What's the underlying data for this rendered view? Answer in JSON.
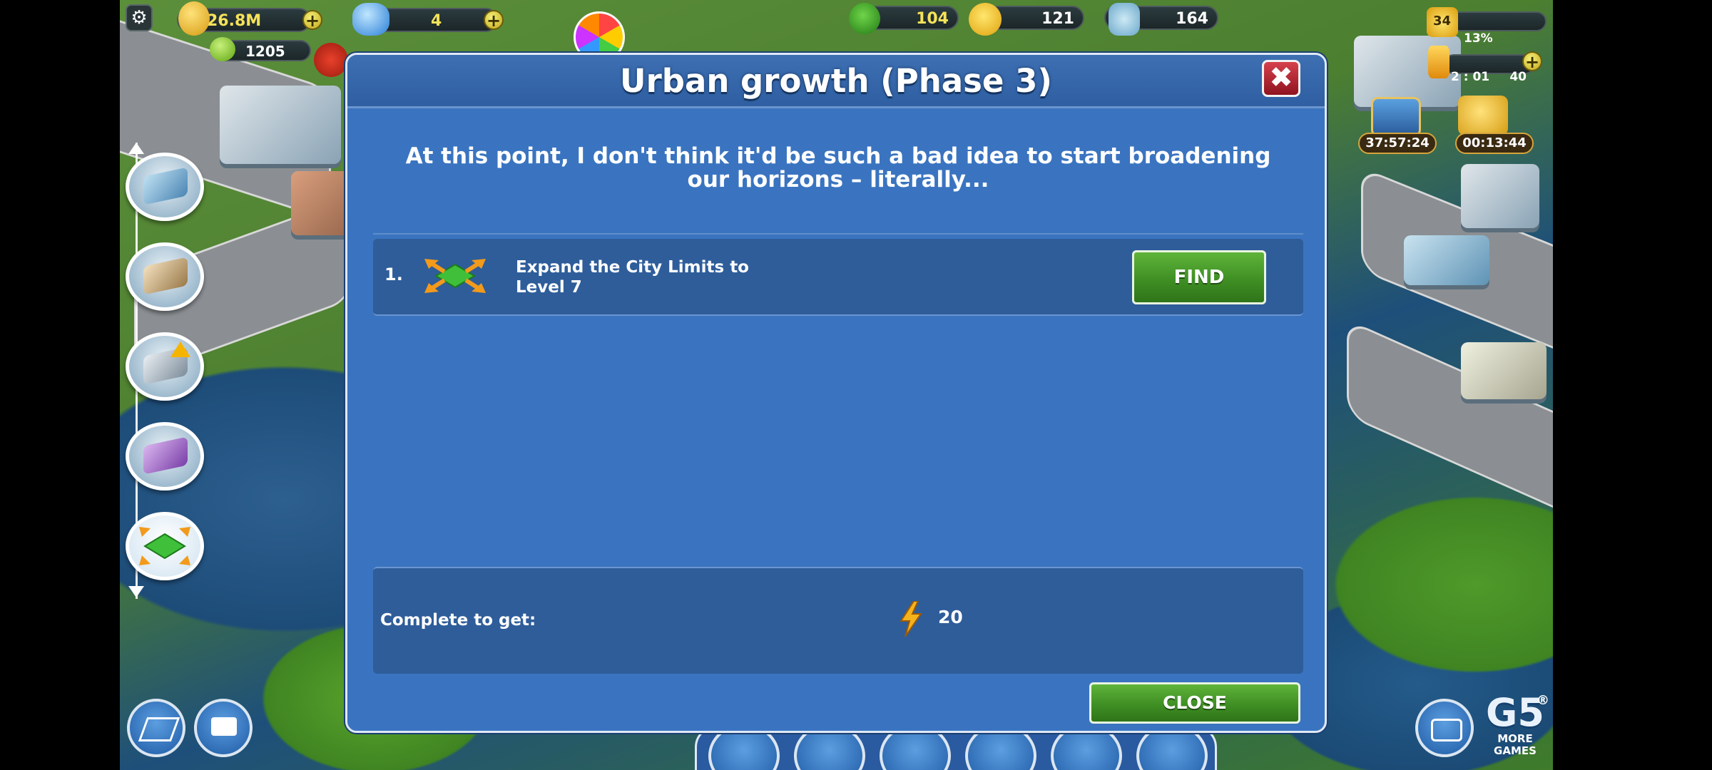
{
  "hud": {
    "coins": "26.8M",
    "diamonds": "4",
    "small_coins": "1205",
    "trees": "104",
    "happiness": "121",
    "population": "164",
    "level": "34",
    "xp_percent": "13%",
    "energy_timer": "2 : 01",
    "energy_value": "40",
    "chest_timer": "37:57:24",
    "coins_timer": "00:13:44",
    "add": "+"
  },
  "dialog": {
    "title": "Urban growth (Phase 3)",
    "close_x": "✖",
    "intro": "At this point, I don't think it'd be such a bad idea to start broadening our horizons – literally...",
    "task": {
      "number": "1.",
      "text": "Expand the City Limits to Level 7",
      "find_label": "FIND"
    },
    "reward": {
      "label": "Complete to get:",
      "value": "20"
    },
    "close_label": "CLOSE"
  },
  "corner": {
    "brand": "G5",
    "registered": "®",
    "more_games": "MORE GAMES"
  },
  "colors": {
    "dialog_bg": "#3a74c0",
    "panel_bg": "#2e5d9a",
    "button_green": "#3f8f24",
    "close_red": "#b52230"
  }
}
